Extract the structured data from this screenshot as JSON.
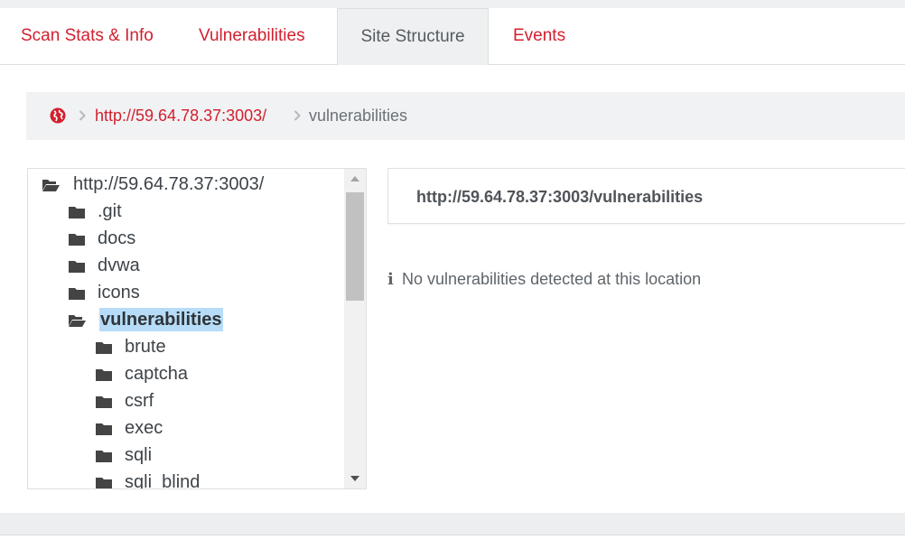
{
  "tabs": [
    {
      "label": "Scan Stats & Info",
      "active": false
    },
    {
      "label": "Vulnerabilities",
      "active": false
    },
    {
      "label": "Site Structure",
      "active": true
    },
    {
      "label": "Events",
      "active": false
    }
  ],
  "breadcrumb": {
    "globe_icon": "globe-icon",
    "root_link": "http://59.64.78.37:3003/",
    "current": "vulnerabilities"
  },
  "tree": {
    "root": "http://59.64.78.37:3003/",
    "items": [
      {
        "label": ".git",
        "icon": "folder-icon"
      },
      {
        "label": "docs",
        "icon": "folder-icon"
      },
      {
        "label": "dvwa",
        "icon": "folder-icon"
      },
      {
        "label": "icons",
        "icon": "folder-icon"
      },
      {
        "label": "vulnerabilities",
        "icon": "folder-open-icon",
        "selected": true
      },
      {
        "label": "brute",
        "icon": "folder-icon"
      },
      {
        "label": "captcha",
        "icon": "folder-icon"
      },
      {
        "label": "csrf",
        "icon": "folder-icon"
      },
      {
        "label": "exec",
        "icon": "folder-icon"
      },
      {
        "label": "sqli",
        "icon": "folder-icon"
      },
      {
        "label": "sqli_blind",
        "icon": "folder-icon"
      }
    ]
  },
  "detail": {
    "url": "http://59.64.78.37:3003/vulnerabilities",
    "info_icon": "info-icon",
    "message": "No vulnerabilities detected at this location"
  },
  "colors": {
    "accent": "#d2202f",
    "selection": "#b6dcf7",
    "text": "#3d4348"
  }
}
